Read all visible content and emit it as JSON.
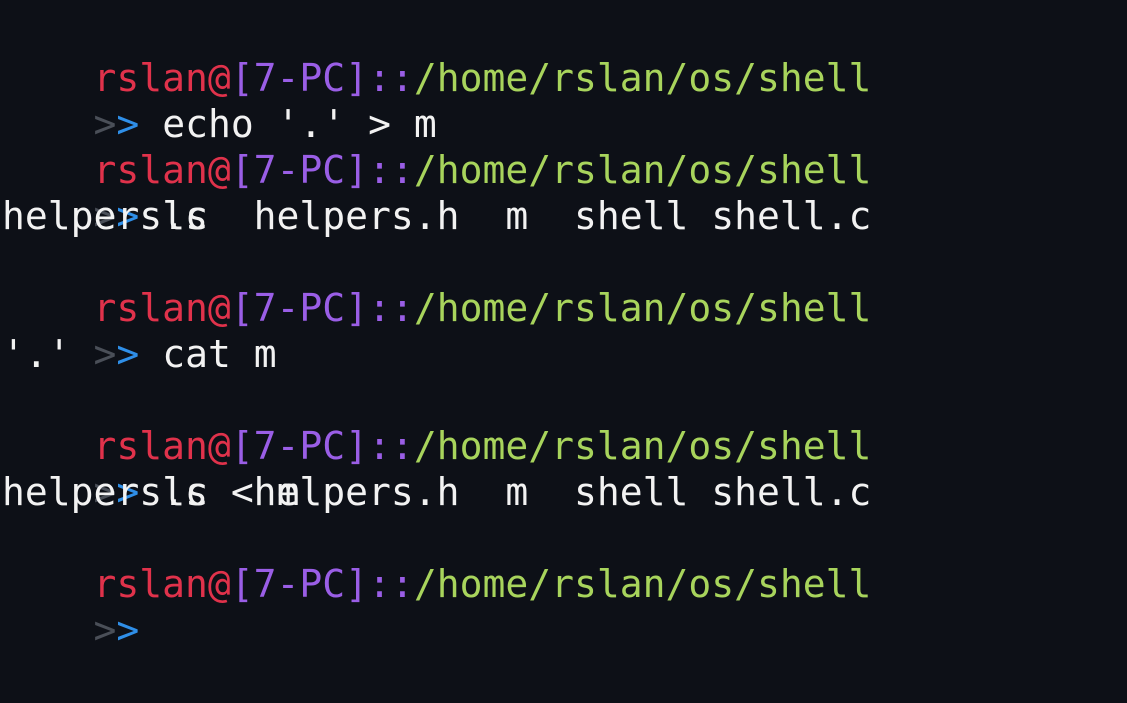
{
  "colors": {
    "background": "#0d1017",
    "user": "#e0324b",
    "host": "#9a5ee6",
    "path": "#a8d45c",
    "prompt_dim": "#4a4f58",
    "prompt_accent": "#2f8fe8",
    "output": "#f2f2f2"
  },
  "prompt": {
    "user": "rslan",
    "at": "@",
    "host": "[7-PC]",
    "sep": "::",
    "path": "/home/rslan/os/shell",
    "marker_dim": ">",
    "marker_accent": ">"
  },
  "session": [
    {
      "command": "echo '.' > m",
      "output": []
    },
    {
      "command": "ls",
      "output": [
        "helpers.c  helpers.h  m  shell shell.c"
      ]
    },
    {
      "command": "cat m",
      "output": [
        "'.'"
      ]
    },
    {
      "command": "ls < m",
      "output": [
        "helpers.c  helpers.h  m  shell shell.c"
      ]
    },
    {
      "command": "",
      "output": []
    }
  ]
}
